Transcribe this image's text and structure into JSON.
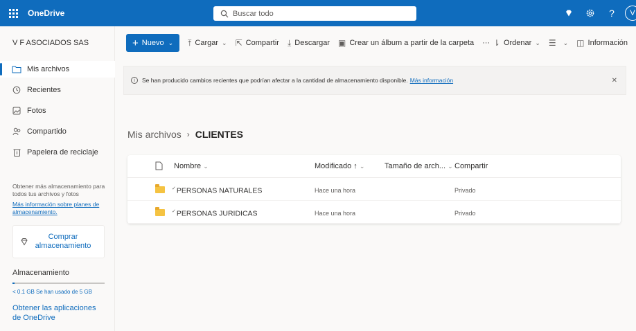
{
  "app": {
    "name": "OneDrive"
  },
  "search": {
    "placeholder": "Buscar todo"
  },
  "account": {
    "initial": "V"
  },
  "sidebar": {
    "org": "V F ASOCIADOS SAS",
    "items": [
      {
        "label": "Mis archivos",
        "icon": "folder-icon",
        "active": true
      },
      {
        "label": "Recientes",
        "icon": "clock-icon"
      },
      {
        "label": "Fotos",
        "icon": "photo-icon"
      },
      {
        "label": "Compartido",
        "icon": "people-icon"
      },
      {
        "label": "Papelera de reciclaje",
        "icon": "trash-icon"
      }
    ],
    "promo_text": "Obtener más almacenamiento para todos tus archivos y fotos",
    "promo_link": "Más información sobre planes de almacenamiento.",
    "buy_label": "Comprar almacenamiento",
    "storage_title": "Almacenamiento",
    "storage_used_fraction": 0.02,
    "storage_text": "< 0.1 GB Se han usado de 5 GB",
    "apps_link": "Obtener las aplicaciones de OneDrive"
  },
  "toolbar": {
    "new_label": "Nuevo",
    "upload_label": "Cargar",
    "share_label": "Compartir",
    "download_label": "Descargar",
    "album_label": "Crear un álbum a partir de la carpeta",
    "more_label": "···",
    "sort_label": "Ordenar",
    "info_label": "Información"
  },
  "banner": {
    "text": "Se han producido cambios recientes que podrían afectar a la cantidad de almacenamiento disponible.",
    "link": "Más información"
  },
  "breadcrumb": {
    "root": "Mis archivos",
    "current": "CLIENTES"
  },
  "table": {
    "headers": {
      "name": "Nombre",
      "modified": "Modificado ↑",
      "size": "Tamaño de arch...",
      "sharing": "Compartir"
    },
    "rows": [
      {
        "name": "PERSONAS NATURALES",
        "modified": "Hace una hora",
        "sharing": "Privado"
      },
      {
        "name": "PERSONAS JURIDICAS",
        "modified": "Hace una hora",
        "sharing": "Privado"
      }
    ]
  }
}
